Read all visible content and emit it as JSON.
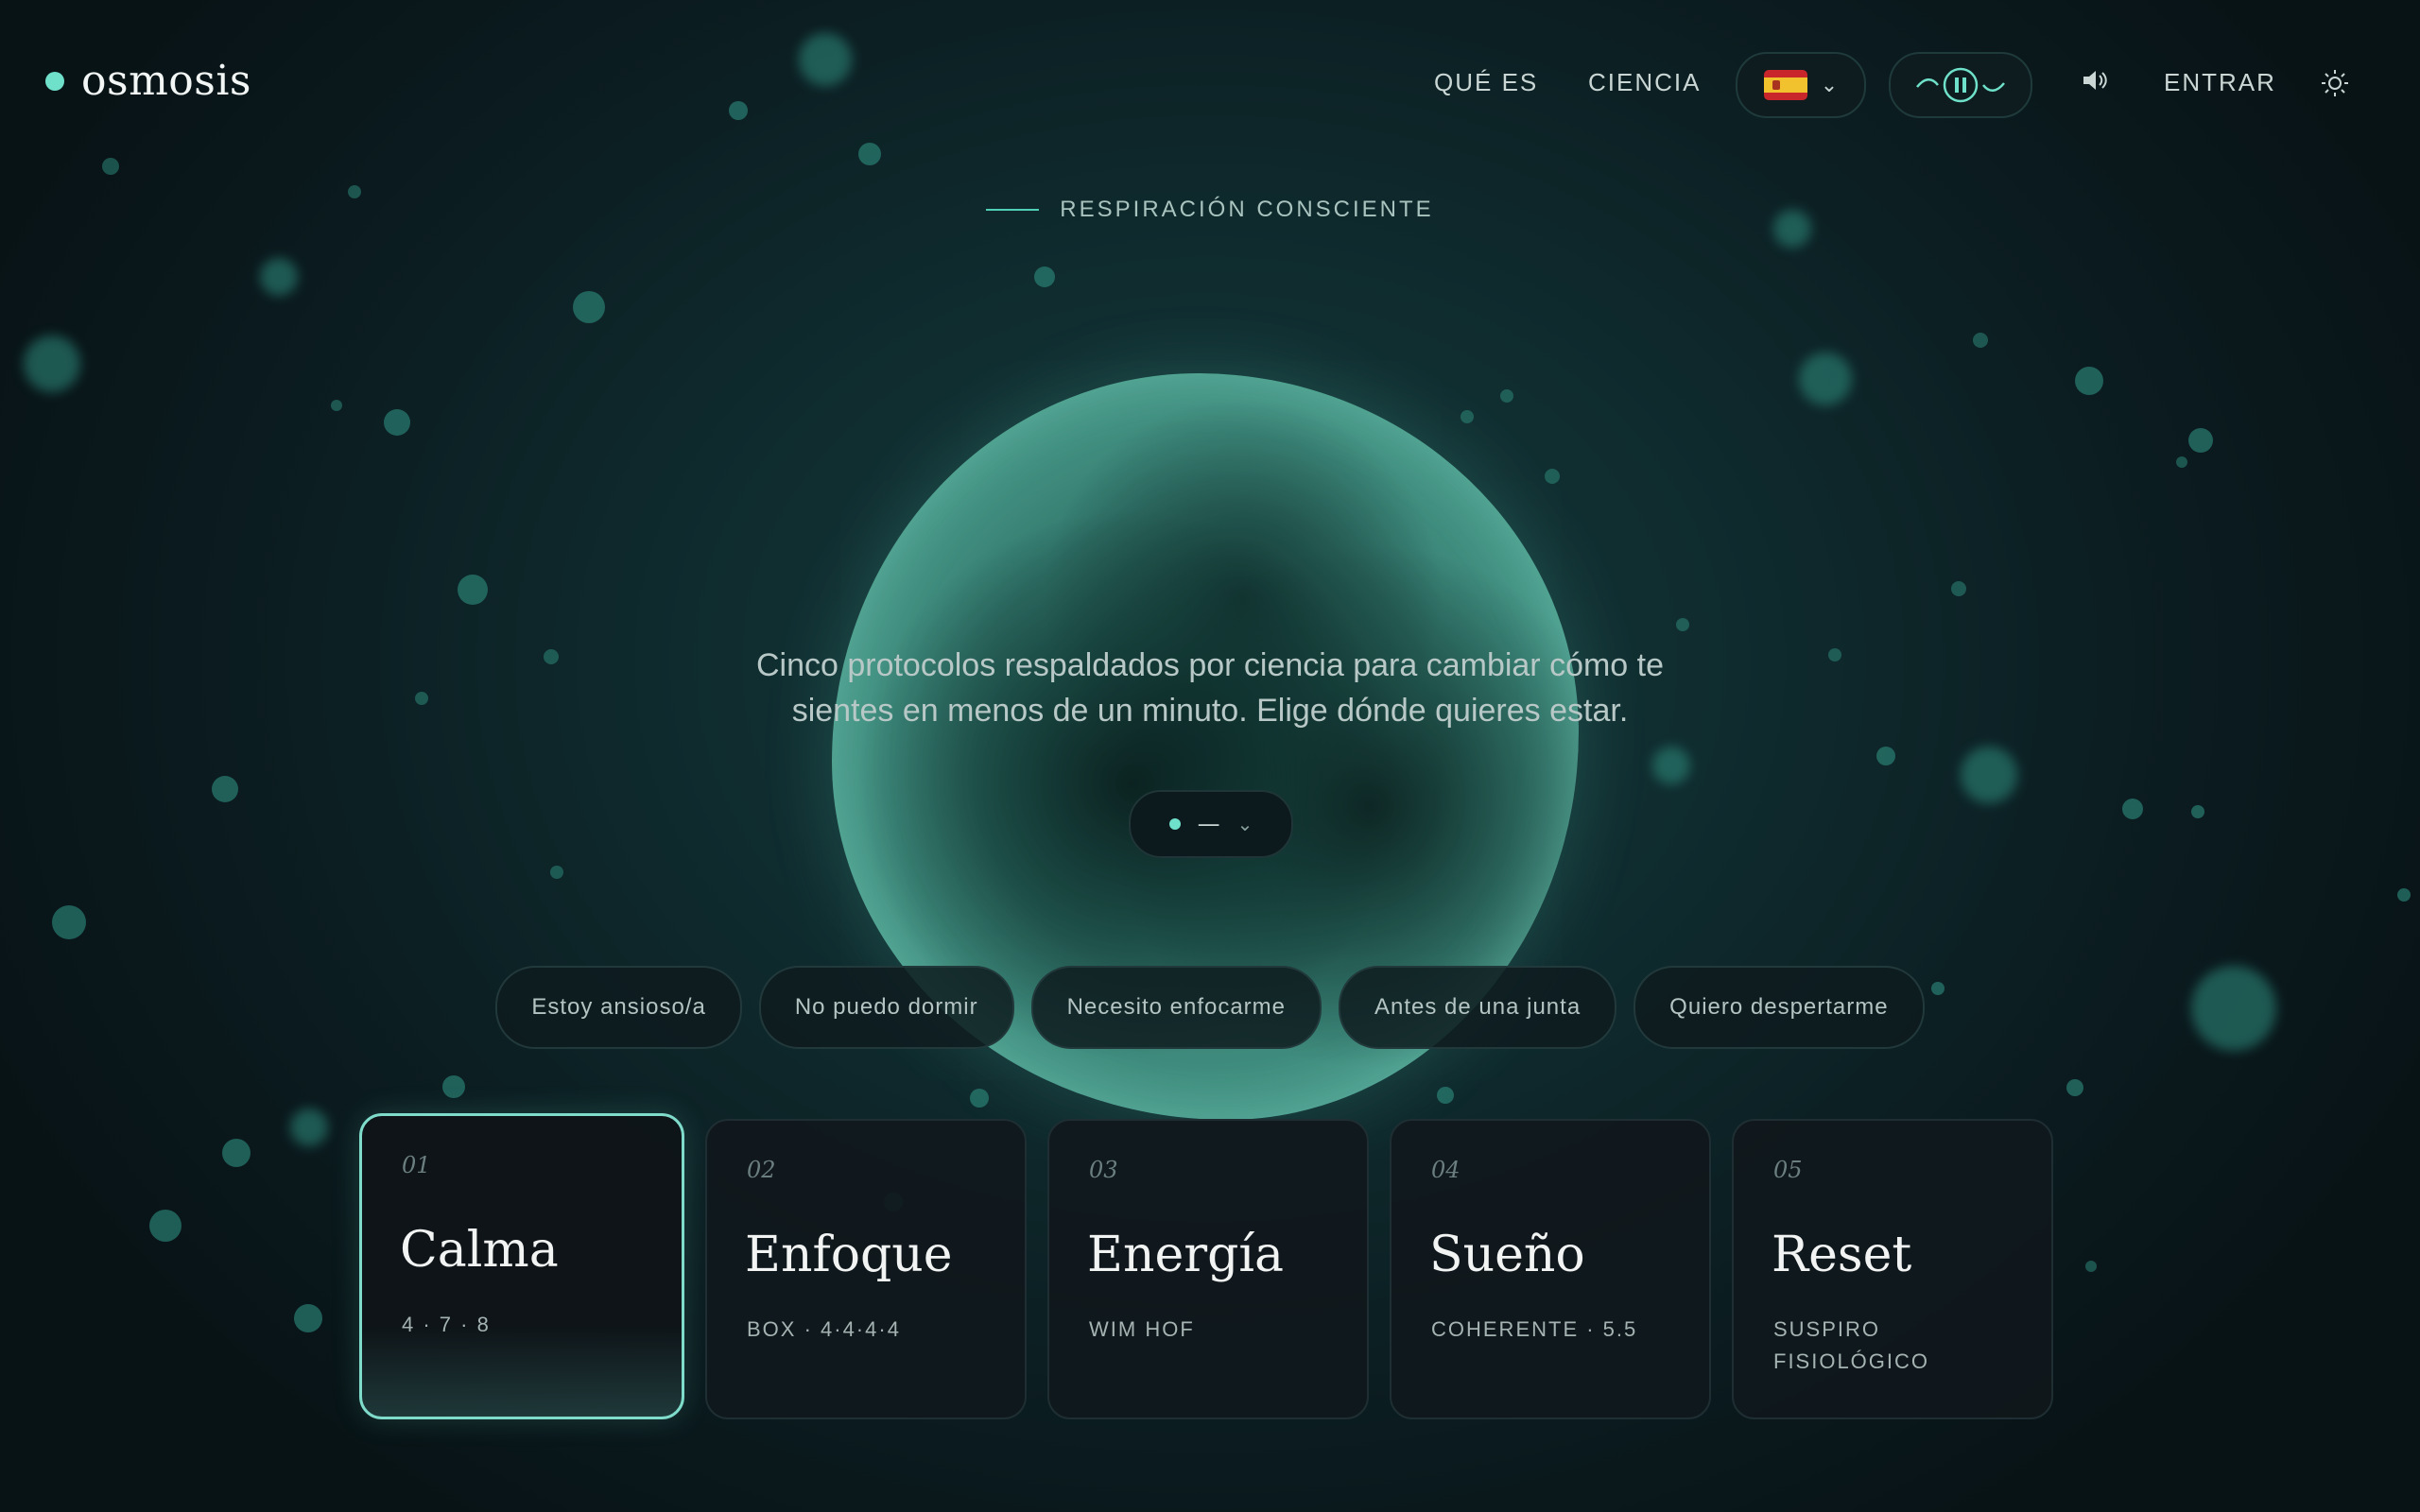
{
  "header": {
    "logo": "osmosis",
    "nav": [
      "QUÉ ES",
      "CIENCIA"
    ],
    "language_flag": "spain-flag-icon",
    "login": "ENTRAR"
  },
  "hero": {
    "eyebrow": "RESPIRACIÓN CONSCIENTE",
    "tagline_line1": "Cinco protocolos respaldados por ciencia para cambiar cómo te",
    "tagline_line2": "sientes en menos de un minuto. Elige dónde quieres estar.",
    "selector_value": "—"
  },
  "chips": [
    "Estoy ansioso/a",
    "No puedo dormir",
    "Necesito enfocarme",
    "Antes de una junta",
    "Quiero despertarme"
  ],
  "cards": [
    {
      "num": "01",
      "title": "Calma",
      "sub": "4 · 7 · 8",
      "active": true
    },
    {
      "num": "02",
      "title": "Enfoque",
      "sub": "BOX · 4·4·4·4"
    },
    {
      "num": "03",
      "title": "Energía",
      "sub": "WIM HOF"
    },
    {
      "num": "04",
      "title": "Sueño",
      "sub": "COHERENTE · 5.5"
    },
    {
      "num": "05",
      "title": "Reset",
      "sub": "SUSPIRO FISIOLÓGICO"
    }
  ],
  "colors": {
    "accent": "#6fe0c9",
    "background": "#0f2b2e"
  }
}
